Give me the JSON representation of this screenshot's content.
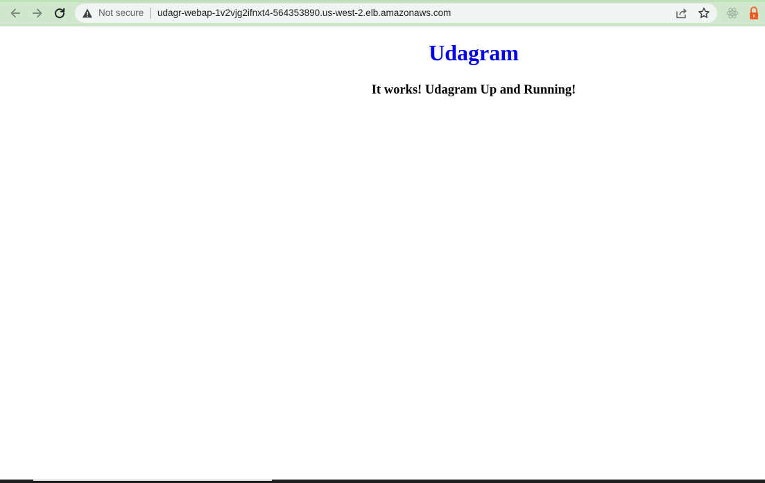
{
  "browser": {
    "security_label": "Not secure",
    "url": "udagr-webap-1v2vjg2ifnxt4-564353890.us-west-2.elb.amazonaws.com",
    "icons": {
      "back": "back-arrow-icon",
      "forward": "forward-arrow-icon",
      "reload": "reload-icon",
      "warning": "warning-triangle-icon",
      "share": "share-icon",
      "bookmark": "star-icon",
      "extension_react": "react-devtools-icon",
      "extension_lock": "lock-extension-icon"
    },
    "colors": {
      "toolbar": "#cfe8cc",
      "omnibox": "#f1f5f1"
    }
  },
  "page": {
    "title": "Udagram",
    "subtitle": "It works! Udagram Up and Running!",
    "colors": {
      "title": "#0000ee",
      "subtitle": "#000000"
    }
  }
}
